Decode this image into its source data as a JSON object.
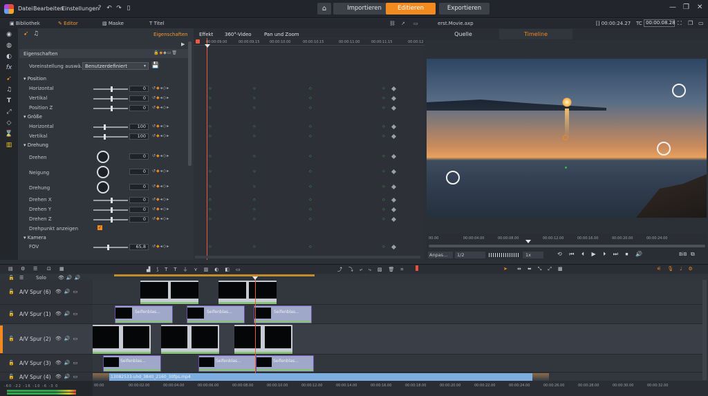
{
  "menu": {
    "file": "Datei",
    "edit": "Bearbeiten",
    "settings": "Einstellungen"
  },
  "modes": {
    "import": "Importieren",
    "edit": "Editieren",
    "export": "Exportieren"
  },
  "tabs": {
    "library": "Bibliothek",
    "editor": "Editor",
    "mask": "Maske",
    "title": "Titel"
  },
  "subtabs": {
    "properties": "Eigenschaften",
    "effect": "Effekt",
    "video360": "360°-Video",
    "panzoom": "Pan und Zoom"
  },
  "kf_ruler": [
    "00:00:09.00",
    "00:00:09.15",
    "00:00:10.00",
    "00:00:10.15",
    "00:00:11.00",
    "00:00:11.15",
    "00:00:12"
  ],
  "props": {
    "header": "Eigenschaften",
    "preset_label": "Voreinstellung auswä...",
    "preset_value": "Benutzerdefiniert",
    "position": "Position",
    "horizontal": "Horizontal",
    "vertical": "Vertikal",
    "position_z": "Position Z",
    "size": "Größe",
    "size_h": "Horizontal",
    "size_v": "Vertikal",
    "rotation": "Drehung",
    "rotate": "Drehen",
    "tilt": "Neigung",
    "twist": "Drehung",
    "rot_x": "Drehen X",
    "rot_y": "Drehen Y",
    "rot_z": "Drehen Z",
    "pivot": "Drehpunkt anzeigen",
    "camera": "Kamera",
    "fov": "FOV",
    "values": {
      "h": "0",
      "v": "0",
      "z": "0",
      "sh": "100",
      "sv": "100",
      "rot": "0",
      "tilt": "0",
      "twist": "0",
      "rx": "0",
      "ry": "0",
      "rz": "0",
      "fov": "65,8"
    }
  },
  "preview": {
    "filename": "erst.Movie.axp",
    "tc_left": "00:00:24.27",
    "tc_label": "TC",
    "tc_right": "00:00:08.28",
    "tab_source": "Quelle",
    "tab_timeline": "Timeline",
    "ruler": [
      "00.00",
      "00:00:04.00",
      "00:00:08.00",
      "00:00:12.00",
      "00:00:16.00",
      "00:00:20.00",
      "00:00:24.00"
    ],
    "fit": "Anpas...",
    "ratio": "1/2",
    "speed": "1x",
    "bib": "BiB"
  },
  "timeline": {
    "solo": "Solo",
    "tracks": [
      "A/V Spur (6)",
      "A/V Spur (1)",
      "A/V Spur (2)",
      "A/V Spur (3)",
      "A/V Spur (4)"
    ],
    "clip_label": "Seifenblas...",
    "long_clip": "13082533-uhd_3840_2160_30fps.mp4",
    "ruler": [
      "00:00",
      "00:00:02.00",
      "00:00:04.00",
      "00:00:06.00",
      "00:00:08.00",
      "00:00:10.00",
      "00:00:12.00",
      "00:00:14.00",
      "00:00:16.00",
      "00:00:18.00",
      "00:00:20.00",
      "00:00:22.00",
      "00:00:24.00",
      "00:00:26.00",
      "00:00:28.00",
      "00:00:30.00",
      "00:00:32.00"
    ]
  },
  "colors": {
    "accent": "#f28a1f",
    "playhead": "#f05a3a",
    "keyframe": "#3cb84a"
  }
}
